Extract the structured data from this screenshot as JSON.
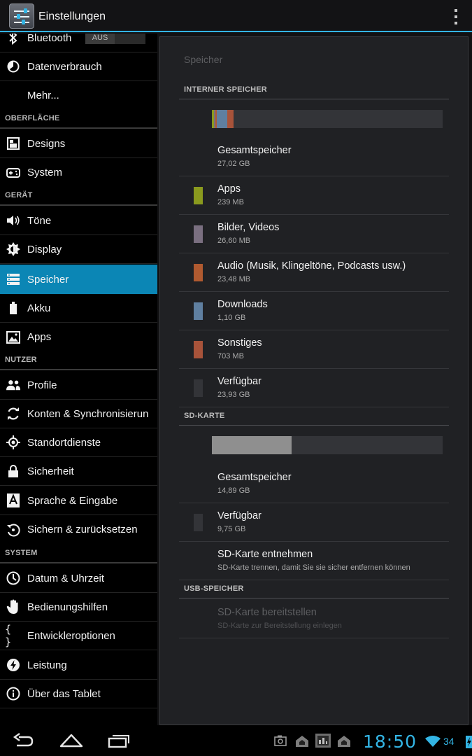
{
  "actionbar": {
    "title": "Einstellungen",
    "app_icon": "settings-sliders-icon",
    "overflow_icon": "overflow-menu-icon"
  },
  "sidebar": {
    "bluetooth": {
      "label": "Bluetooth",
      "toggle": "AUS",
      "icon": "bluetooth-icon"
    },
    "datenverbrauch": {
      "label": "Datenverbrauch",
      "icon": "data-usage-icon"
    },
    "mehr": {
      "label": "Mehr..."
    },
    "headers": {
      "oberflaeche": "OBERFLÄCHE",
      "geraet": "GERÄT",
      "nutzer": "NUTZER",
      "system": "SYSTEM"
    },
    "designs": {
      "label": "Designs",
      "icon": "designs-icon"
    },
    "system_item": {
      "label": "System",
      "icon": "gamepad-icon"
    },
    "toene": {
      "label": "Töne",
      "icon": "volume-icon"
    },
    "display": {
      "label": "Display",
      "icon": "brightness-icon"
    },
    "speicher": {
      "label": "Speicher",
      "icon": "storage-icon"
    },
    "akku": {
      "label": "Akku",
      "icon": "battery-icon"
    },
    "apps": {
      "label": "Apps",
      "icon": "apps-icon"
    },
    "profile": {
      "label": "Profile",
      "icon": "profiles-icon"
    },
    "konten": {
      "label": "Konten & Synchronisierun",
      "icon": "sync-icon"
    },
    "standort": {
      "label": "Standortdienste",
      "icon": "location-icon"
    },
    "sicherheit": {
      "label": "Sicherheit",
      "icon": "lock-icon"
    },
    "sprache": {
      "label": "Sprache & Eingabe",
      "icon": "language-icon"
    },
    "sichern": {
      "label": "Sichern & zurücksetzen",
      "icon": "backup-icon"
    },
    "datum": {
      "label": "Datum & Uhrzeit",
      "icon": "clock-icon"
    },
    "bedienungshilfen": {
      "label": "Bedienungshilfen",
      "icon": "hand-icon"
    },
    "entwickler": {
      "label": "Entwickleroptionen",
      "icon": "braces-icon"
    },
    "leistung": {
      "label": "Leistung",
      "icon": "performance-icon"
    },
    "ueber": {
      "label": "Über das Tablet",
      "icon": "info-icon"
    }
  },
  "content": {
    "heading": "Speicher",
    "internal": {
      "header": "INTERNER SPEICHER",
      "bar_segments": [
        {
          "name": "Apps",
          "color": "#8a9a1e",
          "fraction": 0.009
        },
        {
          "name": "Bilder, Videos",
          "color": "#7a6f80",
          "fraction": 0.006
        },
        {
          "name": "Audio",
          "color": "#b05a30",
          "fraction": 0.005
        },
        {
          "name": "Downloads",
          "color": "#5f7fa0",
          "fraction": 0.045
        },
        {
          "name": "Sonstiges",
          "color": "#a8533a",
          "fraction": 0.026
        }
      ],
      "rows": [
        {
          "title": "Gesamtspeicher",
          "value": "27,02 GB"
        },
        {
          "title": "Apps",
          "value": "239 MB",
          "color": "#8a9a1e"
        },
        {
          "title": "Bilder, Videos",
          "value": "26,60 MB",
          "color": "#7a6f80"
        },
        {
          "title": "Audio (Musik, Klingeltöne, Podcasts usw.)",
          "value": "23,48 MB",
          "color": "#b05a30"
        },
        {
          "title": "Downloads",
          "value": "1,10 GB",
          "color": "#5f7fa0"
        },
        {
          "title": "Sonstiges",
          "value": "703 MB",
          "color": "#a8533a"
        },
        {
          "title": "Verfügbar",
          "value": "23,93 GB",
          "color": "#333438"
        }
      ]
    },
    "sd": {
      "header": "SD-KARTE",
      "used_fraction": 0.345,
      "used_color": "#8f8f8f",
      "rows": [
        {
          "title": "Gesamtspeicher",
          "value": "14,89 GB"
        },
        {
          "title": "Verfügbar",
          "value": "9,75 GB",
          "color": "#333438"
        },
        {
          "title": "SD-Karte entnehmen",
          "value": "SD-Karte trennen, damit Sie sie sicher entfernen können"
        }
      ]
    },
    "usb": {
      "header": "USB-SPEICHER",
      "rows": [
        {
          "title": "SD-Karte bereitstellen",
          "value": "SD-Karte zur Bereitstellung einlegen"
        }
      ]
    }
  },
  "navbar": {
    "back_icon": "back-icon",
    "home_icon": "home-icon",
    "recents_icon": "recents-icon",
    "status_icons": [
      "camera-icon",
      "notification-icon",
      "screenshot-icon",
      "notification-icon"
    ],
    "clock": "18:50",
    "battery": "34"
  }
}
